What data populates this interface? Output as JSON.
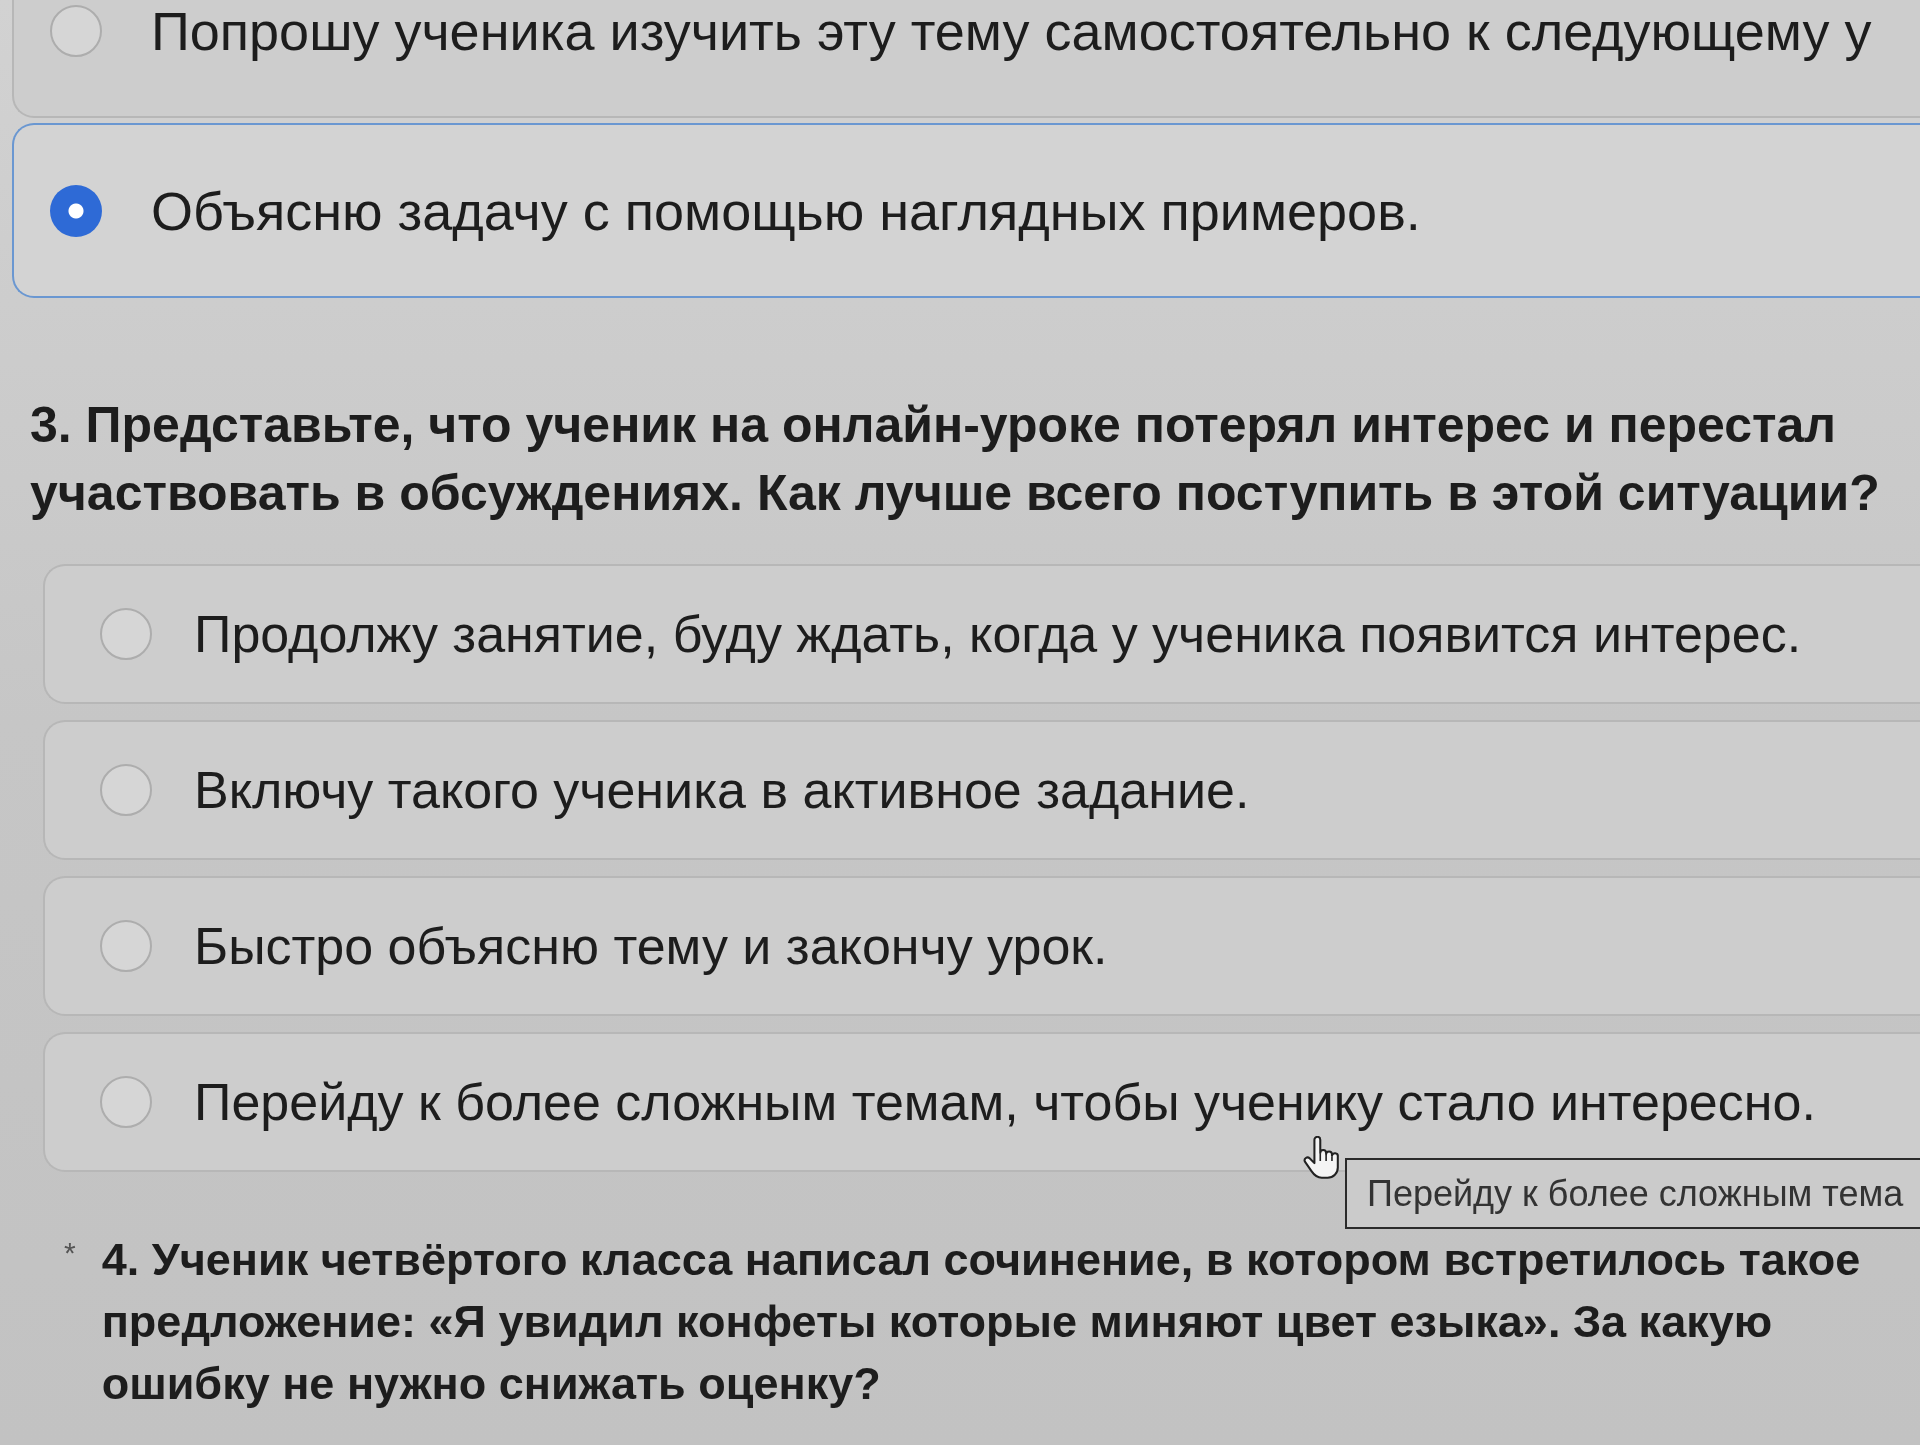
{
  "questions": [
    {
      "options": [
        {
          "label": "Попрошу ученика изучить эту тему самостоятельно к следующему у",
          "selected": false
        },
        {
          "label": "Объясню задачу с помощью наглядных примеров.",
          "selected": true
        }
      ]
    },
    {
      "title": "3. Представьте, что ученик на онлайн-уроке потерял интерес и перестал участвовать в обсуждениях. Как лучше всего поступить в этой ситуации?",
      "options": [
        {
          "label": "Продолжу занятие, буду ждать, когда у ученика появится интерес.",
          "selected": false
        },
        {
          "label": "Включу такого ученика в активное задание.",
          "selected": false
        },
        {
          "label": "Быстро объясню тему и закончу урок.",
          "selected": false
        },
        {
          "label": "Перейду к более сложным темам, чтобы ученику стало интересно.",
          "selected": false
        }
      ],
      "tooltip": "Перейду к более сложным тема"
    },
    {
      "required_mark": "*",
      "title": "4. Ученик четвёртого класса написал сочинение, в котором встретилось такое предложение: «Я увидил конфеты которые миняют цвет езыка». За какую ошибку не нужно снижать оценку?"
    }
  ]
}
